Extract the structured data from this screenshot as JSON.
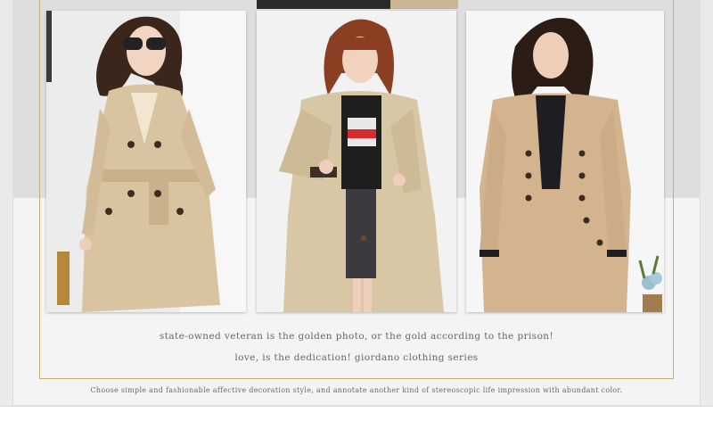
{
  "photos": [
    {
      "name": "model-1-photo",
      "alt": "Woman in beige double-breasted belted trench coat with sunglasses"
    },
    {
      "name": "model-2-photo",
      "alt": "Woman in khaki oversized trench coat over graphic t-shirt"
    },
    {
      "name": "model-3-photo",
      "alt": "Woman in camel double-breasted trench coat with black top"
    }
  ],
  "captions": {
    "line1": "state-owned veteran is the golden photo, or the gold according to the prison!",
    "line2": "love, is the dedication! giordano clothing series"
  },
  "footer": {
    "text": "Choose simple and fashionable affective decoration style, and annotate another kind of stereoscopic life impression with abundant color."
  },
  "colors": {
    "gold_border": "#c9ae72",
    "coat_beige": "#d9c4a2",
    "coat_camel": "#d3b48f"
  }
}
